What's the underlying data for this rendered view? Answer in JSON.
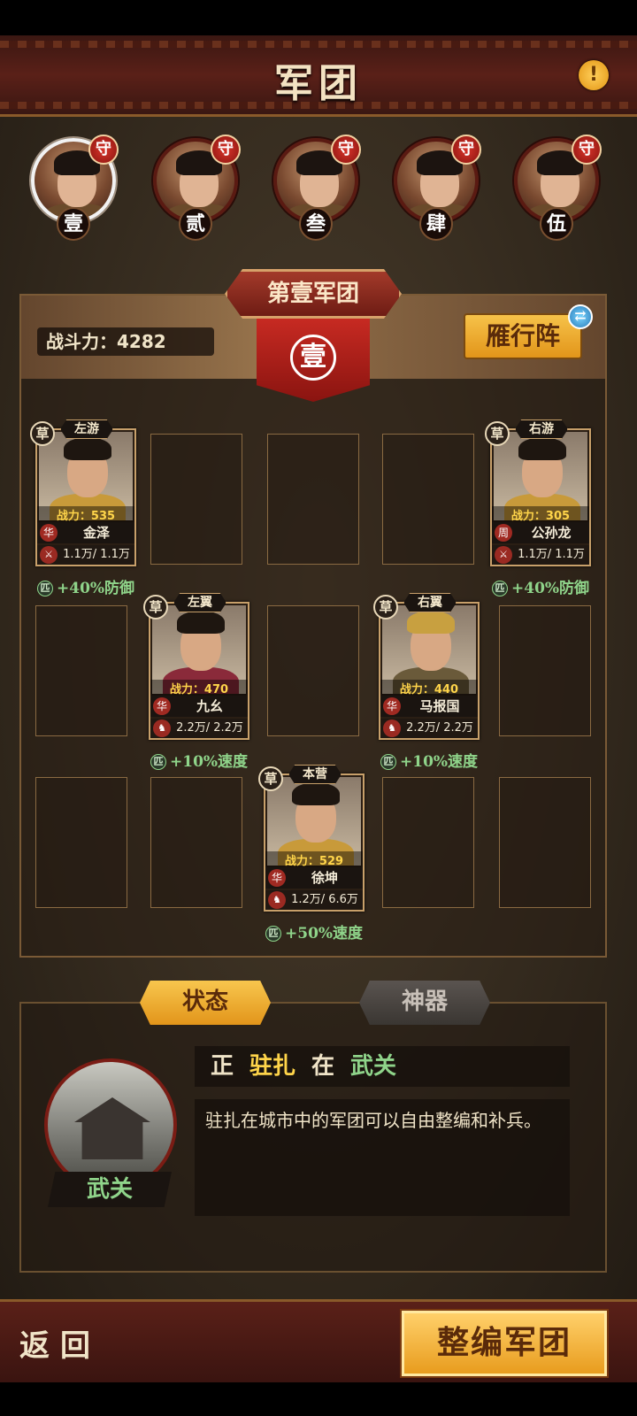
{
  "header": {
    "title": "军团",
    "info_icon": "!"
  },
  "heroes": [
    {
      "num": "壹",
      "badge": "守",
      "selected": true
    },
    {
      "num": "贰",
      "badge": "守",
      "selected": false
    },
    {
      "num": "叁",
      "badge": "守",
      "selected": false
    },
    {
      "num": "肆",
      "badge": "守",
      "selected": false
    },
    {
      "num": "伍",
      "badge": "守",
      "selected": false
    }
  ],
  "legion": {
    "name": "第壹军团",
    "emblem": "壹",
    "power_label": "战斗力：",
    "power_value": "4282",
    "formation": "雁行阵"
  },
  "cards": [
    {
      "grade": "草",
      "position": "左游",
      "power": "战力：535",
      "faction": "华",
      "name": "金泽",
      "troops": "1.1万/ 1.1万",
      "buff": "+40%防御",
      "buff_icon": "匹"
    },
    {
      "grade": "草",
      "position": "右游",
      "power": "战力：305",
      "faction": "周",
      "name": "公孙龙",
      "troops": "1.1万/ 1.1万",
      "buff": "+40%防御",
      "buff_icon": "匹"
    },
    {
      "grade": "草",
      "position": "左翼",
      "power": "战力：470",
      "faction": "华",
      "name": "九幺",
      "troops": "2.2万/ 2.2万",
      "buff": "+10%速度",
      "buff_icon": "匹"
    },
    {
      "grade": "草",
      "position": "右翼",
      "power": "战力：440",
      "faction": "华",
      "name": "马报国",
      "troops": "2.2万/ 2.2万",
      "buff": "+10%速度",
      "buff_icon": "匹"
    },
    {
      "grade": "草",
      "position": "本营",
      "power": "战力：529",
      "faction": "华",
      "name": "徐坤",
      "troops": "1.2万/ 6.6万",
      "buff": "+50%速度",
      "buff_icon": "匹"
    }
  ],
  "tabs": {
    "status": "状态",
    "artifact": "神器"
  },
  "status": {
    "w1": "正",
    "w2": "驻扎",
    "w3": "在",
    "w4": "武关",
    "city": "武关",
    "description": "驻扎在城市中的军团可以自由整编和补兵。"
  },
  "footer": {
    "back": "返回",
    "reorganize": "整编军团"
  },
  "colors": {
    "accent_gold": "#f6c24a",
    "banner_red": "#a33a2a",
    "buff_green": "#8fd48a"
  }
}
